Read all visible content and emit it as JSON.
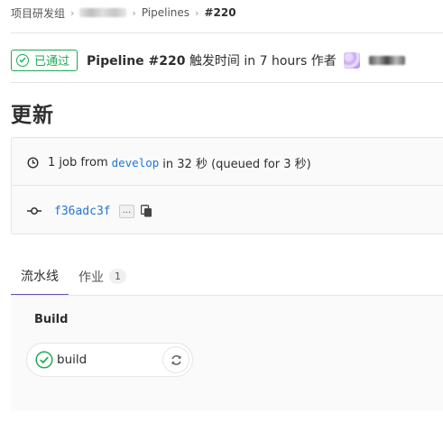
{
  "breadcrumb": {
    "group": "项目研发组",
    "pipelines": "Pipelines",
    "current": "#220",
    "separator": "›"
  },
  "header": {
    "status_label": "已通过",
    "pipeline_id": "Pipeline #220",
    "triggered_text": "触发时间 in 7 hours 作者",
    "status_color": "#1aaa55"
  },
  "page_title": "更新",
  "info": {
    "job_summary_prefix": "1 job from",
    "branch": "develop",
    "duration_text": "in 32 秒 (queued for 3 秒)",
    "commit_sha": "f36adc3f",
    "ellipsis": "..."
  },
  "tabs": [
    {
      "label": "流水线"
    },
    {
      "label": "作业",
      "count": "1"
    }
  ],
  "graph": {
    "stage_name": "Build",
    "job_name": "build",
    "job_status": "passed"
  },
  "icons": {
    "status_icon": "check-circle-icon",
    "clock_icon": "clock-icon",
    "commit_icon": "commit-icon",
    "copy_icon": "clipboard-icon",
    "retry_icon": "retry-icon"
  },
  "colors": {
    "success": "#1aaa55",
    "link": "#1f78d1",
    "tab_active": "#6b4fbb"
  }
}
